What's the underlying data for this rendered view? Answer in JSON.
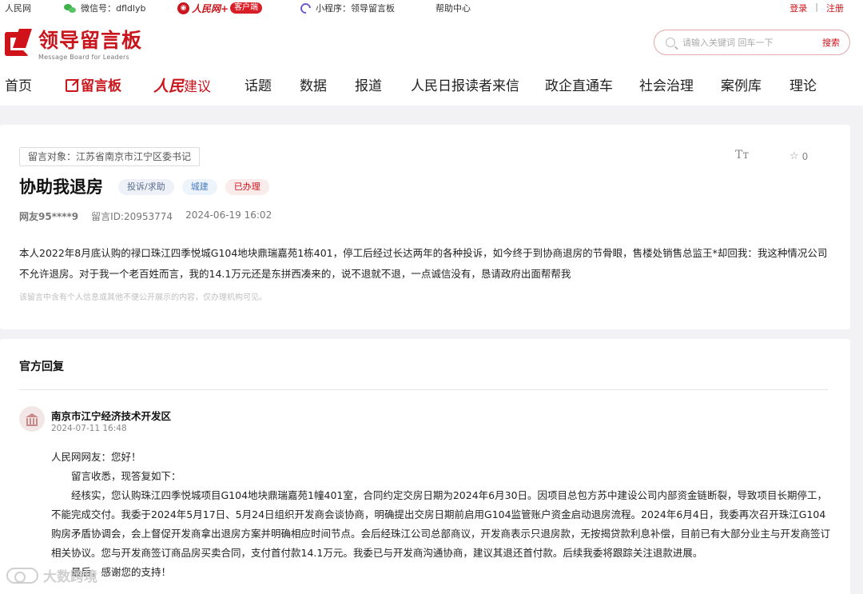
{
  "topbar": {
    "site": "人民网",
    "wechat": "微信号：dfldlyb",
    "app_brand": "人民网+",
    "app_pill": "客户端",
    "mini_program": "小程序：领导留言板",
    "help": "帮助中心",
    "login": "登录",
    "separator": "|",
    "register": "注册",
    "colors": {
      "wechat": "#3fb24b",
      "accent": "#d0121b"
    }
  },
  "header": {
    "logo_cn": "领导留言板",
    "logo_en": "Message Board for Leaders",
    "search_placeholder": "请输入关键词 回车一下",
    "search_button": "搜索"
  },
  "nav": {
    "items": [
      {
        "label": "首页",
        "active": false
      },
      {
        "label": "留言板",
        "active": true,
        "icon": "pen-icon"
      },
      {
        "label_ital": "人民",
        "label": "建议",
        "style": "brand"
      },
      {
        "label": "话题"
      },
      {
        "label": "数据"
      },
      {
        "label": "报道"
      },
      {
        "label": "人民日报读者来信"
      },
      {
        "label": "政企直通车"
      },
      {
        "label": "社会治理"
      },
      {
        "label": "案例库"
      },
      {
        "label": "理论"
      }
    ]
  },
  "message": {
    "target": "留言对象：江苏省南京市江宁区委书记",
    "font_toggle": "Tт",
    "fav_count": "0",
    "title": "协助我退房",
    "tags": [
      "投诉/求助",
      "城建",
      "已办理"
    ],
    "user": "网友95****9",
    "id": "留言ID:20953774",
    "date": "2024-06-19 16:02",
    "body": "本人2022年8月底认购的禄口珠江四季悦城G104地块鼎瑞嘉苑1栋401，停工后经过长达两年的各种投诉，如今终于到协商退房的节骨眼，售楼处销售总监王*却回我：我这种情况公司不允许退房。对于我一个老百姓而言，我的14.1万元还是东拼西凑来的，说不退就不退，一点诚信没有，恳请政府出面帮帮我",
    "privacy_note": "该留言中含有个人信息或其他不便公开展示的内容，仅办理机构可见。"
  },
  "reply": {
    "heading": "官方回复",
    "org": "南京市江宁经济技术开发区",
    "date": "2024-07-11 16:48",
    "greeting": "人民网网友：您好！",
    "p1": "留言收悉，现答复如下：",
    "p2": "经核实，您认购珠江四季悦城项目G104地块鼎瑞嘉苑1幢401室，合同约定交房日期为2024年6月30日。因项目总包方苏中建设公司内部资金链断裂，导致项目长期停工，不能完成交付。我委于2024年5月17日、5月24日组织开发商会谈协商，明确提出交房日期前启用G104监管账户资金启动退房流程。2024年6月4日，我委再次召开珠江G104购房矛盾协调会，会上督促开发商拿出退房方案并明确相应时间节点。会后经珠江公司总部商议，开发商表示只退房款，无按揭贷款利息补偿，目前已有大部分业主与开发商签订相关协议。您与开发商签订商品房买卖合同，支付首付款14.1万元。我委已与开发商沟通协商，建议其退还首付款。后续我委将跟踪关注退款进展。",
    "p3": "最后，感谢您的支持！"
  },
  "watermark": "大数跨境"
}
